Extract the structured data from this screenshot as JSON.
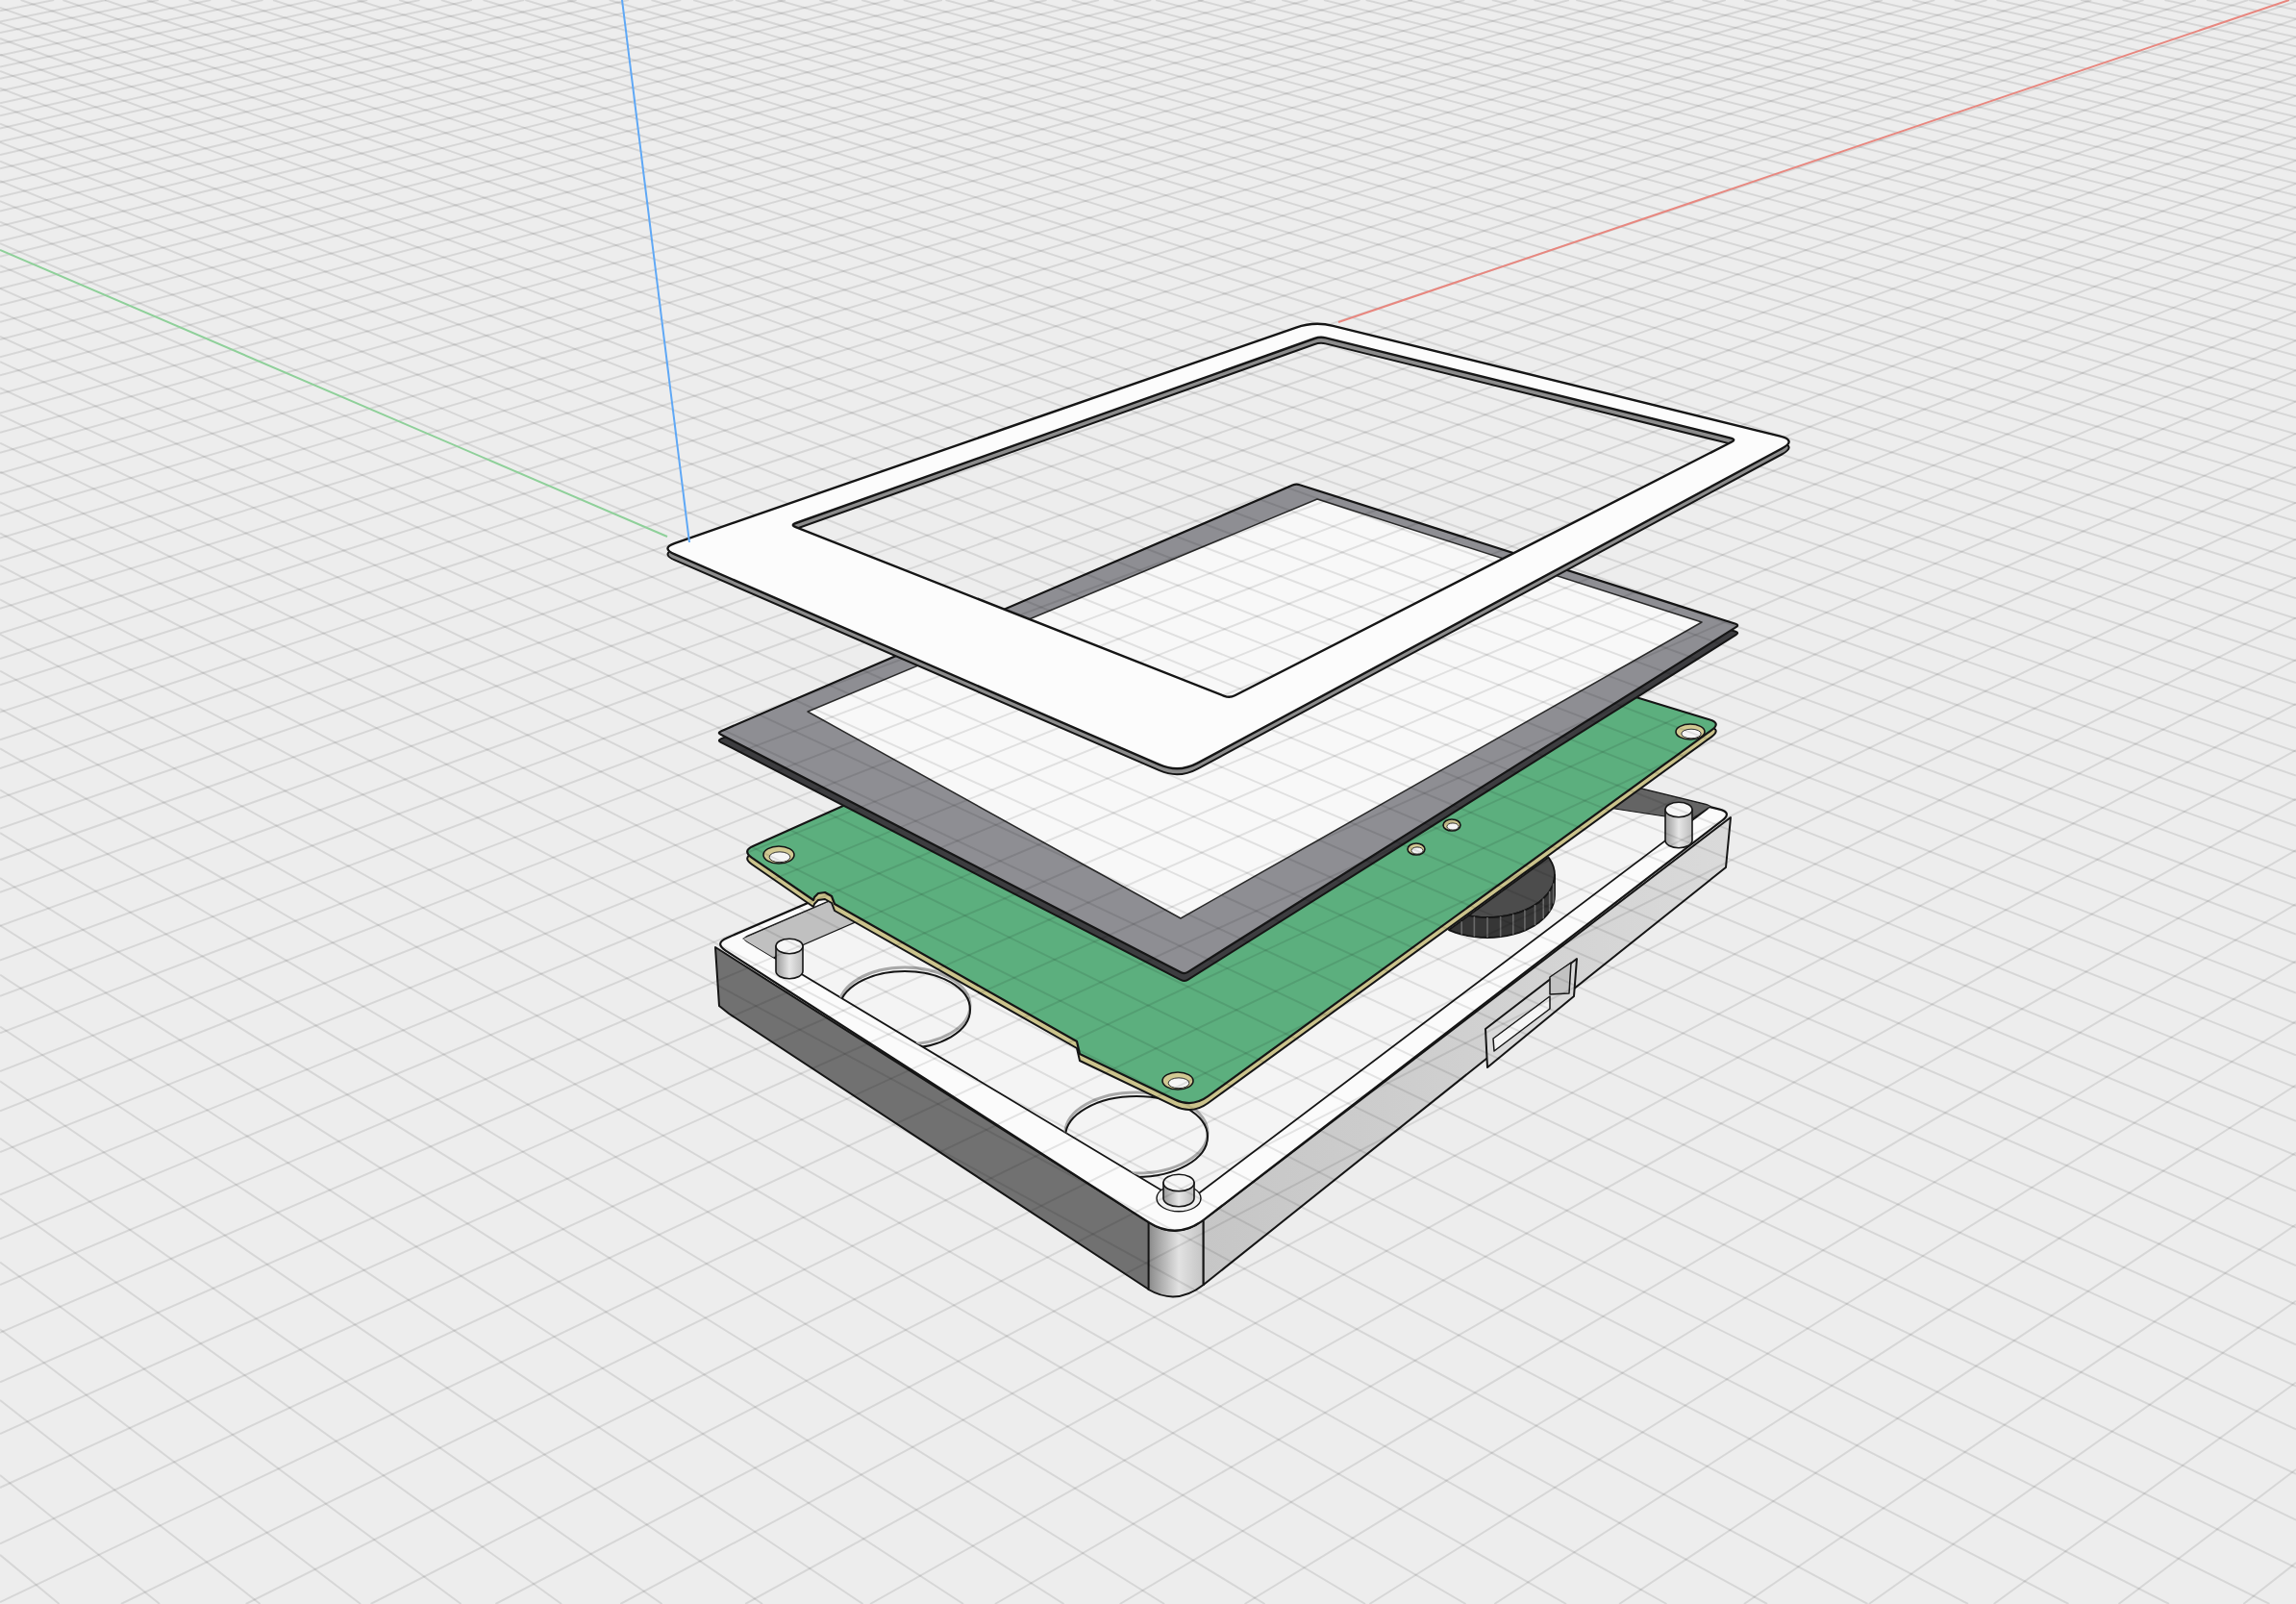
{
  "viewport": {
    "axes": [
      {
        "kind": "x",
        "color": "#e8877f"
      },
      {
        "kind": "y",
        "color": "#8fd09a"
      },
      {
        "kind": "z",
        "color": "#5fa8f6"
      }
    ],
    "parts": [
      {
        "kind": "bezel"
      },
      {
        "kind": "display"
      },
      {
        "kind": "circuit_board"
      },
      {
        "kind": "knob"
      },
      {
        "kind": "enclosure"
      }
    ]
  }
}
